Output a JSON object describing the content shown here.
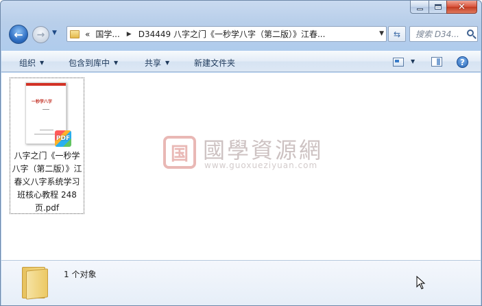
{
  "window": {
    "caption": {
      "minimize": "–",
      "maximize": "□",
      "close": "✕"
    }
  },
  "nav": {
    "back_glyph": "←",
    "forward_glyph": "→",
    "history_glyph": "▼",
    "breadcrumb": {
      "overflow": "«",
      "root": "国学...",
      "path": "D34449 八字之门《一秒学八字（第二版）》江春..."
    },
    "address_dropdown": "▼",
    "refresh_glyph": "⇆",
    "search_placeholder": "搜索 D34..."
  },
  "toolbar": {
    "organize": "组织",
    "include_in_library": "包含到库中",
    "share": "共享",
    "new_folder": "新建文件夹",
    "view_dropdown": "▼",
    "help": "?"
  },
  "files": [
    {
      "name": "八字之门《一秒学八字（第二版）》江春义八字系统学习班核心教程 248页.pdf",
      "thumb_title": "一秒学八字",
      "badge": "PDF"
    }
  ],
  "watermark": {
    "seal": "国",
    "text": "國學資源網",
    "url": "www.guoxueziyuan.com"
  },
  "details": {
    "count": "1 个对象"
  },
  "colors": {
    "accent": "#2f6fc3",
    "close_button": "#d8523a",
    "watermark_red": "#c8463f"
  }
}
